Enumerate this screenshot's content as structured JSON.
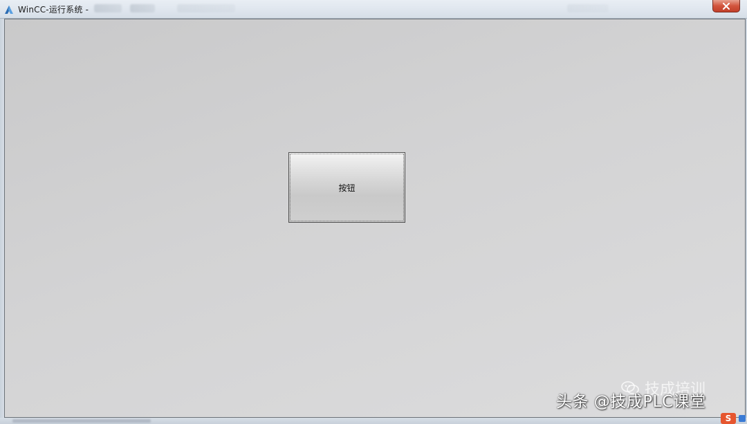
{
  "window": {
    "title": "WinCC-运行系统 -"
  },
  "main": {
    "button_label": "按钮"
  },
  "watermark": {
    "text": "头条 @技成PLC课堂",
    "faint_text": "技成培训"
  },
  "tray": {
    "app_letter": "S"
  },
  "icons": {
    "app": "wincc-logo-icon",
    "close": "close-icon",
    "wechat": "wechat-icon",
    "tray": "sogou-ime-icon"
  },
  "colors": {
    "close_button": "#d2543d",
    "canvas": "#d3d3d4",
    "tray_icon": "#e6562f"
  }
}
